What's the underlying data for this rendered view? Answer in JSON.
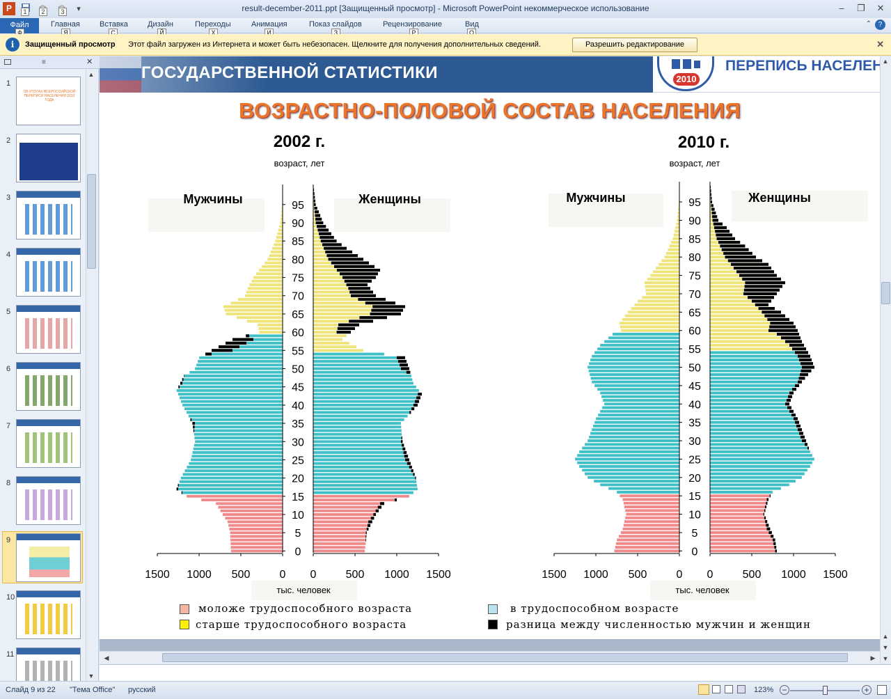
{
  "window": {
    "title": "result-december-2011.ppt [Защищенный просмотр]  -  Microsoft PowerPoint некоммерческое использование",
    "app_icon": "P",
    "quick_access_keys": [
      "1",
      "2",
      "3"
    ]
  },
  "ribbon": {
    "file_tab": "Файл",
    "tabs": [
      "Главная",
      "Вставка",
      "Дизайн",
      "Переходы",
      "Анимация",
      "Показ слайдов",
      "Рецензирование",
      "Вид"
    ],
    "key_tips": [
      "Ф",
      "Я",
      "С",
      "Й",
      "Х",
      "И",
      "З",
      "Р",
      "О"
    ]
  },
  "message_bar": {
    "label": "Защищенный просмотр",
    "text": "Этот файл загружен из Интернета и может быть небезопасен. Щелкните для получения дополнительных сведений.",
    "button": "Разрешить редактирование",
    "info_icon": "i"
  },
  "slides_panel": {
    "numbers": [
      "1",
      "2",
      "3",
      "4",
      "5",
      "6",
      "7",
      "8",
      "9",
      "10",
      "11"
    ],
    "selected": 9,
    "thumb1_text": "ОБ ИТОГАХ ВСЕРОССИЙСКОЙ ПЕРЕПИСИ НАСЕЛЕНИЯ 2010 ГОДА"
  },
  "slide": {
    "header_text": "ГОСУДАРСТВЕННОЙ СТАТИСТИКИ",
    "logo_text": "ПЕРЕПИСЬ НАСЕЛЕНИ",
    "logo_year": "2010",
    "title": "ВОЗРАСТНО-ПОЛОВОЙ СОСТАВ НАСЕЛЕНИЯ",
    "legend": {
      "young": "моложе трудоспособного возраста",
      "working": "в трудоспособном возрасте",
      "old": "старше трудоспособного возраста",
      "diff": "разница между численностью мужчин и женщин"
    },
    "colors": {
      "young": "#f08a8a",
      "working": "#3fbfc7",
      "old": "#efe47a",
      "diff": "#000000",
      "title": "#e9762b"
    }
  },
  "chart_data": [
    {
      "type": "bar",
      "title": "2002 г.",
      "ylabel": "возраст, лет",
      "xlabel": "тыс. человек",
      "left_label": "Мужчины",
      "right_label": "Женщины",
      "y_ticks": [
        0,
        5,
        10,
        15,
        20,
        25,
        30,
        35,
        40,
        45,
        50,
        55,
        60,
        65,
        70,
        75,
        80,
        85,
        90,
        95
      ],
      "x_ticks_left": [
        "1500",
        "1000",
        "500",
        "0"
      ],
      "x_ticks_right": [
        "0",
        "500",
        "1000",
        "1500"
      ],
      "xlim": [
        0,
        1500
      ],
      "age_bands": {
        "young": [
          0,
          15
        ],
        "working_men": [
          16,
          59
        ],
        "working_women": [
          16,
          54
        ],
        "old_men": [
          60,
          100
        ],
        "old_women": [
          55,
          100
        ]
      },
      "men_key_points": [
        [
          0,
          620
        ],
        [
          5,
          630
        ],
        [
          8,
          660
        ],
        [
          10,
          720
        ],
        [
          13,
          800
        ],
        [
          15,
          1150
        ],
        [
          17,
          1270
        ],
        [
          20,
          1220
        ],
        [
          25,
          1100
        ],
        [
          30,
          1050
        ],
        [
          35,
          1080
        ],
        [
          40,
          1200
        ],
        [
          44,
          1270
        ],
        [
          48,
          1180
        ],
        [
          50,
          1050
        ],
        [
          53,
          1000
        ],
        [
          55,
          850
        ],
        [
          58,
          600
        ],
        [
          60,
          280
        ],
        [
          62,
          300
        ],
        [
          65,
          680
        ],
        [
          67,
          710
        ],
        [
          70,
          450
        ],
        [
          72,
          420
        ],
        [
          75,
          350
        ],
        [
          78,
          250
        ],
        [
          80,
          180
        ],
        [
          85,
          90
        ],
        [
          90,
          30
        ],
        [
          95,
          8
        ],
        [
          100,
          2
        ]
      ],
      "women_key_points": [
        [
          0,
          620
        ],
        [
          5,
          640
        ],
        [
          10,
          750
        ],
        [
          13,
          850
        ],
        [
          15,
          1150
        ],
        [
          17,
          1250
        ],
        [
          20,
          1230
        ],
        [
          25,
          1150
        ],
        [
          30,
          1070
        ],
        [
          35,
          1050
        ],
        [
          40,
          1250
        ],
        [
          43,
          1300
        ],
        [
          46,
          1200
        ],
        [
          50,
          1150
        ],
        [
          53,
          1100
        ],
        [
          55,
          600
        ],
        [
          58,
          350
        ],
        [
          60,
          450
        ],
        [
          62,
          550
        ],
        [
          65,
          1050
        ],
        [
          67,
          1100
        ],
        [
          70,
          750
        ],
        [
          73,
          650
        ],
        [
          75,
          750
        ],
        [
          77,
          800
        ],
        [
          80,
          600
        ],
        [
          83,
          400
        ],
        [
          85,
          280
        ],
        [
          90,
          120
        ],
        [
          95,
          30
        ],
        [
          100,
          4
        ]
      ]
    },
    {
      "type": "bar",
      "title": "2010 г.",
      "ylabel": "возраст, лет",
      "xlabel": "тыс. человек",
      "left_label": "Мужчины",
      "right_label": "Женщины",
      "y_ticks": [
        0,
        5,
        10,
        15,
        20,
        25,
        30,
        35,
        40,
        45,
        50,
        55,
        60,
        65,
        70,
        75,
        80,
        85,
        90,
        95
      ],
      "x_ticks_left": [
        "1500",
        "1000",
        "500",
        "0"
      ],
      "x_ticks_right": [
        "0",
        "500",
        "1000",
        "1500"
      ],
      "xlim": [
        0,
        1500
      ],
      "age_bands": {
        "young": [
          0,
          15
        ],
        "working_men": [
          16,
          59
        ],
        "working_women": [
          16,
          54
        ],
        "old_men": [
          60,
          100
        ],
        "old_women": [
          55,
          100
        ]
      },
      "men_key_points": [
        [
          0,
          780
        ],
        [
          3,
          750
        ],
        [
          6,
          680
        ],
        [
          10,
          640
        ],
        [
          14,
          680
        ],
        [
          16,
          750
        ],
        [
          18,
          950
        ],
        [
          20,
          1100
        ],
        [
          23,
          1200
        ],
        [
          25,
          1250
        ],
        [
          27,
          1200
        ],
        [
          30,
          1100
        ],
        [
          33,
          1050
        ],
        [
          36,
          1000
        ],
        [
          40,
          900
        ],
        [
          43,
          950
        ],
        [
          46,
          1050
        ],
        [
          50,
          1100
        ],
        [
          53,
          1050
        ],
        [
          56,
          950
        ],
        [
          59,
          800
        ],
        [
          60,
          700
        ],
        [
          62,
          720
        ],
        [
          65,
          620
        ],
        [
          68,
          500
        ],
        [
          70,
          400
        ],
        [
          73,
          420
        ],
        [
          75,
          350
        ],
        [
          78,
          250
        ],
        [
          80,
          180
        ],
        [
          85,
          80
        ],
        [
          90,
          30
        ],
        [
          95,
          8
        ],
        [
          100,
          2
        ]
      ],
      "women_key_points": [
        [
          0,
          800
        ],
        [
          3,
          780
        ],
        [
          6,
          720
        ],
        [
          10,
          650
        ],
        [
          14,
          700
        ],
        [
          16,
          750
        ],
        [
          18,
          950
        ],
        [
          20,
          1100
        ],
        [
          23,
          1200
        ],
        [
          25,
          1250
        ],
        [
          27,
          1200
        ],
        [
          30,
          1150
        ],
        [
          33,
          1100
        ],
        [
          36,
          1050
        ],
        [
          40,
          950
        ],
        [
          43,
          1000
        ],
        [
          46,
          1100
        ],
        [
          50,
          1250
        ],
        [
          53,
          1200
        ],
        [
          55,
          1150
        ],
        [
          57,
          1100
        ],
        [
          60,
          1050
        ],
        [
          62,
          1000
        ],
        [
          65,
          850
        ],
        [
          67,
          700
        ],
        [
          70,
          800
        ],
        [
          73,
          900
        ],
        [
          75,
          800
        ],
        [
          78,
          700
        ],
        [
          80,
          550
        ],
        [
          83,
          420
        ],
        [
          85,
          300
        ],
        [
          88,
          200
        ],
        [
          90,
          100
        ],
        [
          95,
          25
        ],
        [
          100,
          4
        ]
      ]
    }
  ],
  "status_bar": {
    "slide_info": "Слайд 9 из 22",
    "theme": "\"Тема Office\"",
    "language": "русский",
    "zoom": "123%"
  }
}
